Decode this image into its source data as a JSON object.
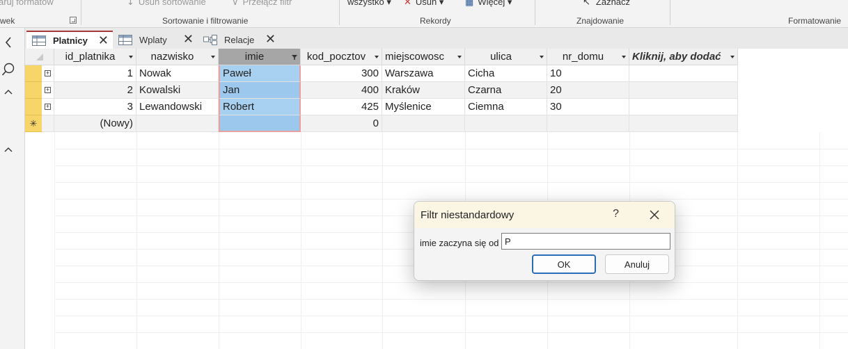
{
  "ribbon": {
    "top_items": [
      {
        "label": "aruj formatow",
        "dark": false
      },
      {
        "label": "Usuń sortowanie",
        "dark": false
      },
      {
        "label": "Przełącz filtr",
        "dark": false
      },
      {
        "label": "wszystko",
        "dark": true
      },
      {
        "label": "Usuń",
        "dark": true
      },
      {
        "label": "Więcej",
        "dark": true
      },
      {
        "label": "Zaznacz",
        "dark": true
      }
    ],
    "groups": {
      "g0": "wek",
      "g1": "Sortowanie i filtrowanie",
      "g2": "Rekordy",
      "g3": "Znajdowanie",
      "g4": "Formatowanie"
    }
  },
  "nav": {
    "collapse_icon": "‹",
    "search_icon": "⌕",
    "up_icon": "^"
  },
  "tabs": [
    {
      "label": "Platnicy",
      "close": "✕"
    },
    {
      "label": "Wplaty",
      "close": "✕"
    },
    {
      "label": "Relacje",
      "close": "✕"
    }
  ],
  "table": {
    "columns": [
      "id_platnika",
      "nazwisko",
      "imie",
      "kod_pocztov",
      "miejscowosc",
      "ulica",
      "nr_domu",
      "Kliknij, aby dodać"
    ],
    "rows": [
      {
        "id_platnika": "1",
        "nazwisko": "Nowak",
        "imie": "Paweł",
        "kod_pocztowy": "300",
        "miejscowosc": "Warszawa",
        "ulica": "Cicha",
        "nr_domu": "10"
      },
      {
        "id_platnika": "2",
        "nazwisko": "Kowalski",
        "imie": "Jan",
        "kod_pocztowy": "400",
        "miejscowosc": "Kraków",
        "ulica": "Czarna",
        "nr_domu": "20"
      },
      {
        "id_platnika": "3",
        "nazwisko": "Lewandowski",
        "imie": "Robert",
        "kod_pocztowy": "425",
        "miejscowosc": "Myślenice",
        "ulica": "Ciemna",
        "nr_domu": "30"
      }
    ],
    "new_row": {
      "id_platnika": "(Nowy)",
      "kod_pocztowy": "0",
      "marker": "✳"
    },
    "expand_symbol": "+"
  },
  "dialog": {
    "title": "Filtr niestandardowy",
    "help": "?",
    "close": "✕",
    "label": "imie zaczyna się od",
    "value": "P",
    "ok": "OK",
    "cancel": "Anuluj"
  },
  "colors": {
    "selector": "#f8d568",
    "selected_column": "#a8d0f0",
    "active_tab_accent": "#a4373a",
    "dialog_title_bg": "#fbf6e4"
  }
}
